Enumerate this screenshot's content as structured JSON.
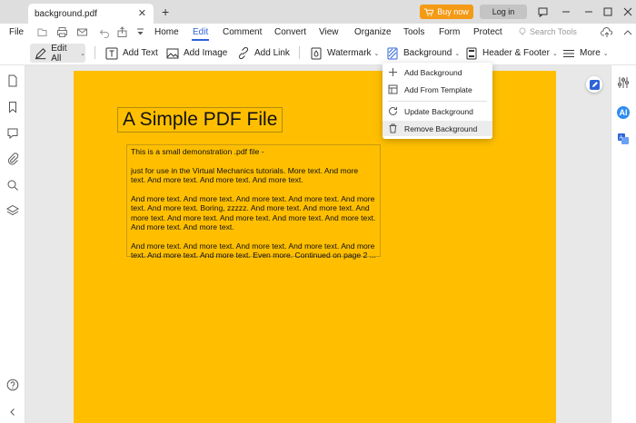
{
  "titlebar": {
    "tab_title": "background.pdf",
    "buy_now": "Buy now",
    "login": "Log in"
  },
  "menubar": {
    "file": "File",
    "items": [
      "Home",
      "Edit",
      "Comment",
      "Convert",
      "View",
      "Organize",
      "Tools",
      "Form",
      "Protect"
    ],
    "active": "Edit",
    "search_placeholder": "Search Tools"
  },
  "toolbar": {
    "edit_all": "Edit All",
    "add_text": "Add Text",
    "add_image": "Add Image",
    "add_link": "Add Link",
    "watermark": "Watermark",
    "background": "Background",
    "header_footer": "Header & Footer",
    "more": "More"
  },
  "background_menu": {
    "items": [
      "Add Background",
      "Add From Template",
      "Update Background",
      "Remove Background"
    ]
  },
  "document": {
    "title": "A Simple PDF File",
    "paragraphs": [
      "This is a small demonstration .pdf file -",
      "just for use in the Virtual Mechanics tutorials. More text. And more\ntext. And more text. And more text. And more text.",
      "And more text. And more text. And more text. And more text. And more\ntext. And more text. Boring, zzzzz. And more text. And more text. And\nmore text. And more text. And more text. And more text. And more text.\nAnd more text. And more text.",
      "And more text. And more text. And more text. And more text. And more\ntext. And more text. And more text. Even more. Continued on page 2 ..."
    ],
    "background_color": "#ffbf00"
  },
  "right_sidebar": {
    "ai_label": "AI"
  },
  "colors": {
    "accent": "#2f64d8",
    "buy": "#f59a15"
  }
}
